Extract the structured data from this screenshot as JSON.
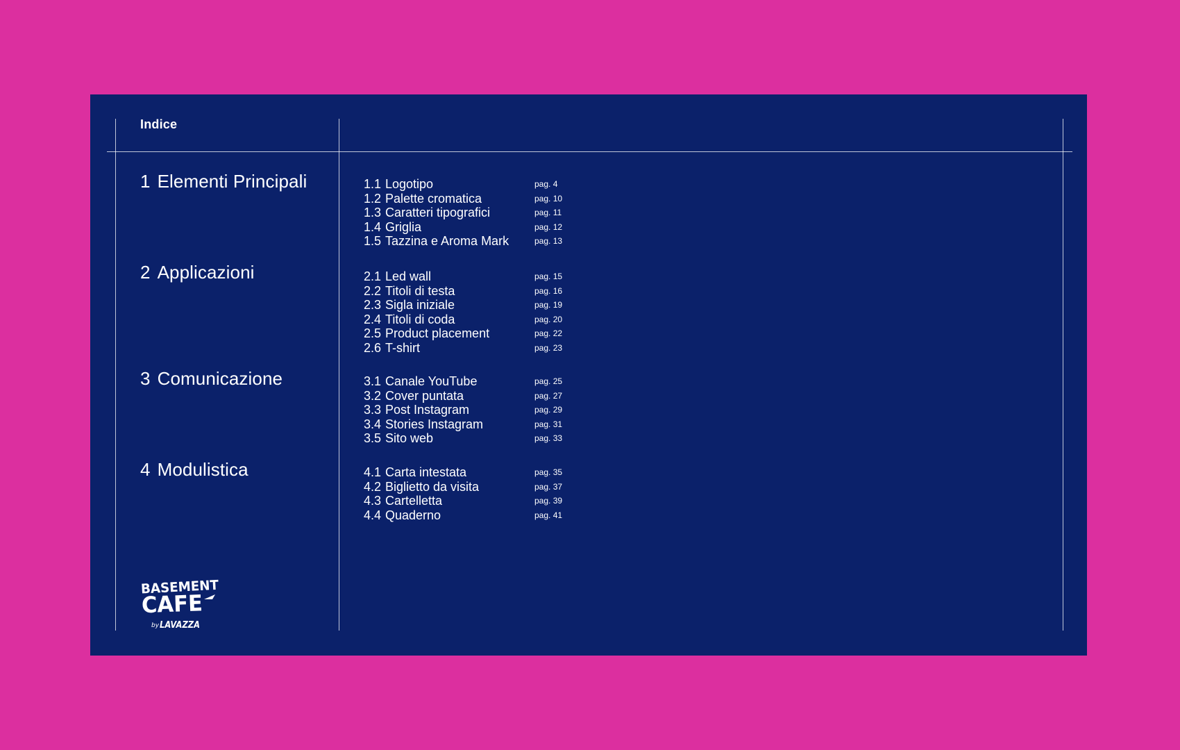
{
  "index_label": "Indice",
  "colors": {
    "background": "#dc2f9f",
    "panel": "#0b216a",
    "text": "#ffffff"
  },
  "sections": [
    {
      "num": "1",
      "title": "Elementi Principali",
      "items": [
        {
          "num": "1.1",
          "label": "Logotipo",
          "page": "pag. 4"
        },
        {
          "num": "1.2",
          "label": "Palette cromatica",
          "page": "pag. 10"
        },
        {
          "num": "1.3",
          "label": "Caratteri tipografici",
          "page": "pag. 11"
        },
        {
          "num": "1.4",
          "label": "Griglia",
          "page": "pag. 12"
        },
        {
          "num": "1.5",
          "label": "Tazzina e Aroma Mark",
          "page": "pag. 13"
        }
      ]
    },
    {
      "num": "2",
      "title": "Applicazioni",
      "items": [
        {
          "num": "2.1",
          "label": "Led wall",
          "page": "pag. 15"
        },
        {
          "num": "2.2",
          "label": "Titoli di testa",
          "page": "pag. 16"
        },
        {
          "num": "2.3",
          "label": "Sigla iniziale",
          "page": "pag. 19"
        },
        {
          "num": "2.4",
          "label": "Titoli di coda",
          "page": "pag. 20"
        },
        {
          "num": "2.5",
          "label": "Product placement",
          "page": "pag. 22"
        },
        {
          "num": "2.6",
          "label": "T-shirt",
          "page": "pag. 23"
        }
      ]
    },
    {
      "num": "3",
      "title": "Comunicazione",
      "items": [
        {
          "num": "3.1",
          "label": "Canale YouTube",
          "page": "pag. 25"
        },
        {
          "num": "3.2",
          "label": "Cover puntata",
          "page": "pag. 27"
        },
        {
          "num": "3.3",
          "label": "Post Instagram",
          "page": "pag. 29"
        },
        {
          "num": "3.4",
          "label": "Stories Instagram",
          "page": "pag. 31"
        },
        {
          "num": "3.5",
          "label": "Sito web",
          "page": "pag. 33"
        }
      ]
    },
    {
      "num": "4",
      "title": "Modulistica",
      "items": [
        {
          "num": "4.1",
          "label": "Carta intestata",
          "page": "pag. 35"
        },
        {
          "num": "4.2",
          "label": "Biglietto da visita",
          "page": "pag. 37"
        },
        {
          "num": "4.3",
          "label": "Cartelletta",
          "page": "pag. 39"
        },
        {
          "num": "4.4",
          "label": "Quaderno",
          "page": "pag. 41"
        }
      ]
    }
  ],
  "logo": {
    "line1": "BASEMENT",
    "line2": "CAFE",
    "by": "by",
    "brand": "LAVAZZA"
  }
}
